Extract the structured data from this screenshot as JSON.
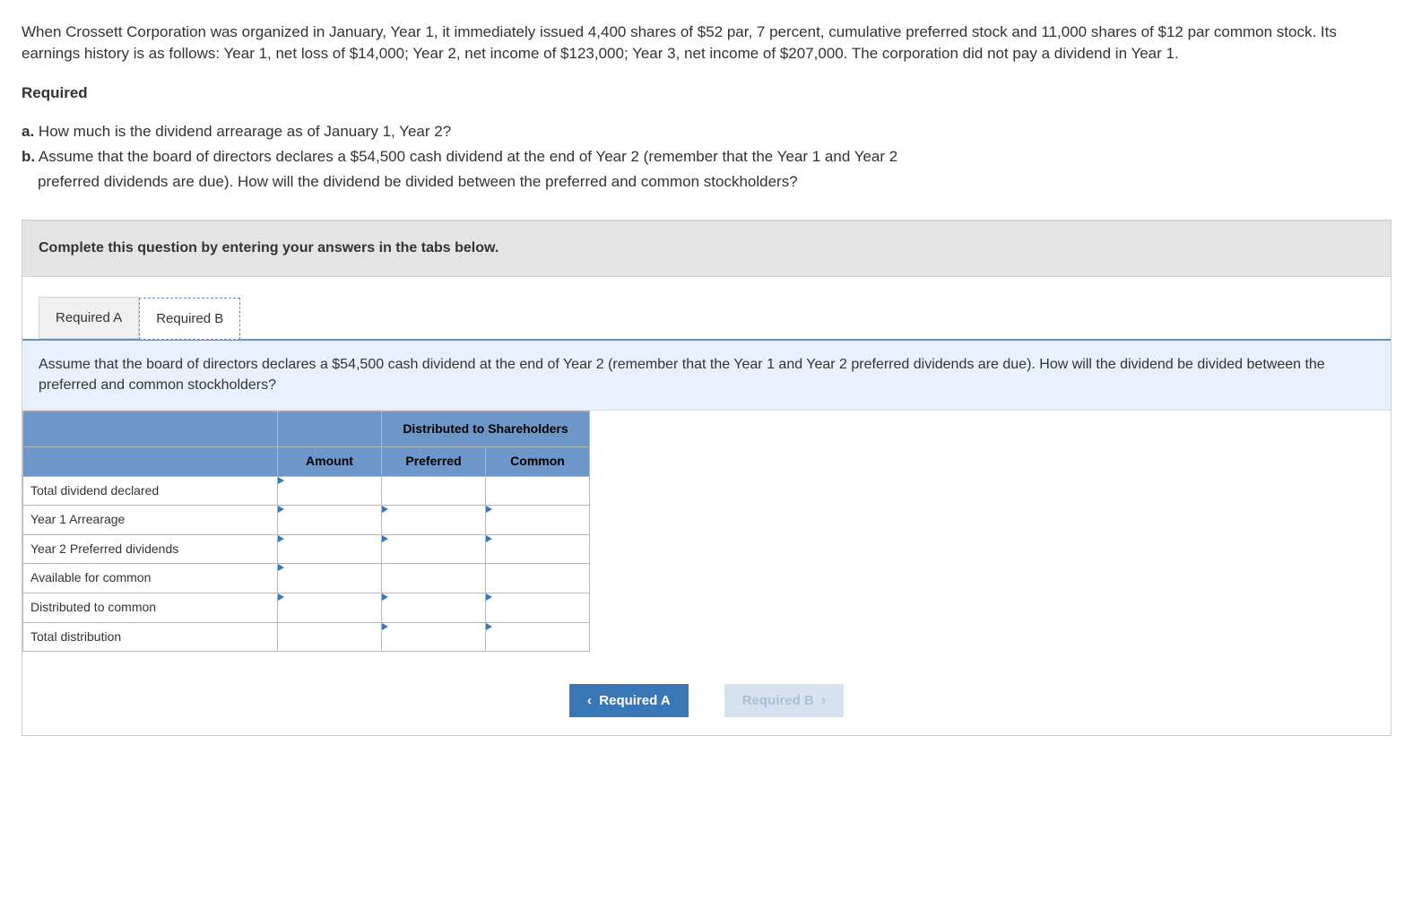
{
  "problem": {
    "text": "When Crossett Corporation was organized in January, Year 1, it immediately issued 4,400 shares of $52 par, 7 percent, cumulative preferred stock and 11,000 shares of $12 par common stock. Its earnings history is as follows: Year 1, net loss of $14,000; Year 2, net income of $123,000; Year 3, net income of $207,000. The corporation did not pay a dividend in Year 1."
  },
  "required": {
    "heading": "Required",
    "items": {
      "a_label": "a.",
      "a_text": "How much is the dividend arrearage as of January 1, Year 2?",
      "b_label": "b.",
      "b_text_line1": "Assume that the board of directors declares a $54,500 cash dividend at the end of Year 2 (remember that the Year 1 and Year 2",
      "b_text_line2": "preferred dividends are due). How will the dividend be divided between the preferred and common stockholders?"
    }
  },
  "banner": "Complete this question by entering your answers in the tabs below.",
  "tabs": {
    "a": "Required A",
    "b": "Required B"
  },
  "panel": {
    "text": "Assume that the board of directors declares a $54,500 cash dividend at the end of Year 2 (remember that the Year 1 and Year 2 preferred dividends are due). How will the dividend be divided between the preferred and common stockholders?"
  },
  "table": {
    "headers": {
      "dist": "Distributed to Shareholders",
      "amount": "Amount",
      "preferred": "Preferred",
      "common": "Common"
    },
    "rows": {
      "r1": "Total dividend declared",
      "r2": "Year 1 Arrearage",
      "r3": "Year 2 Preferred dividends",
      "r4": "Available for common",
      "r5": "Distributed to common",
      "r6": "Total distribution"
    }
  },
  "nav": {
    "prev": "Required A",
    "next": "Required B"
  }
}
